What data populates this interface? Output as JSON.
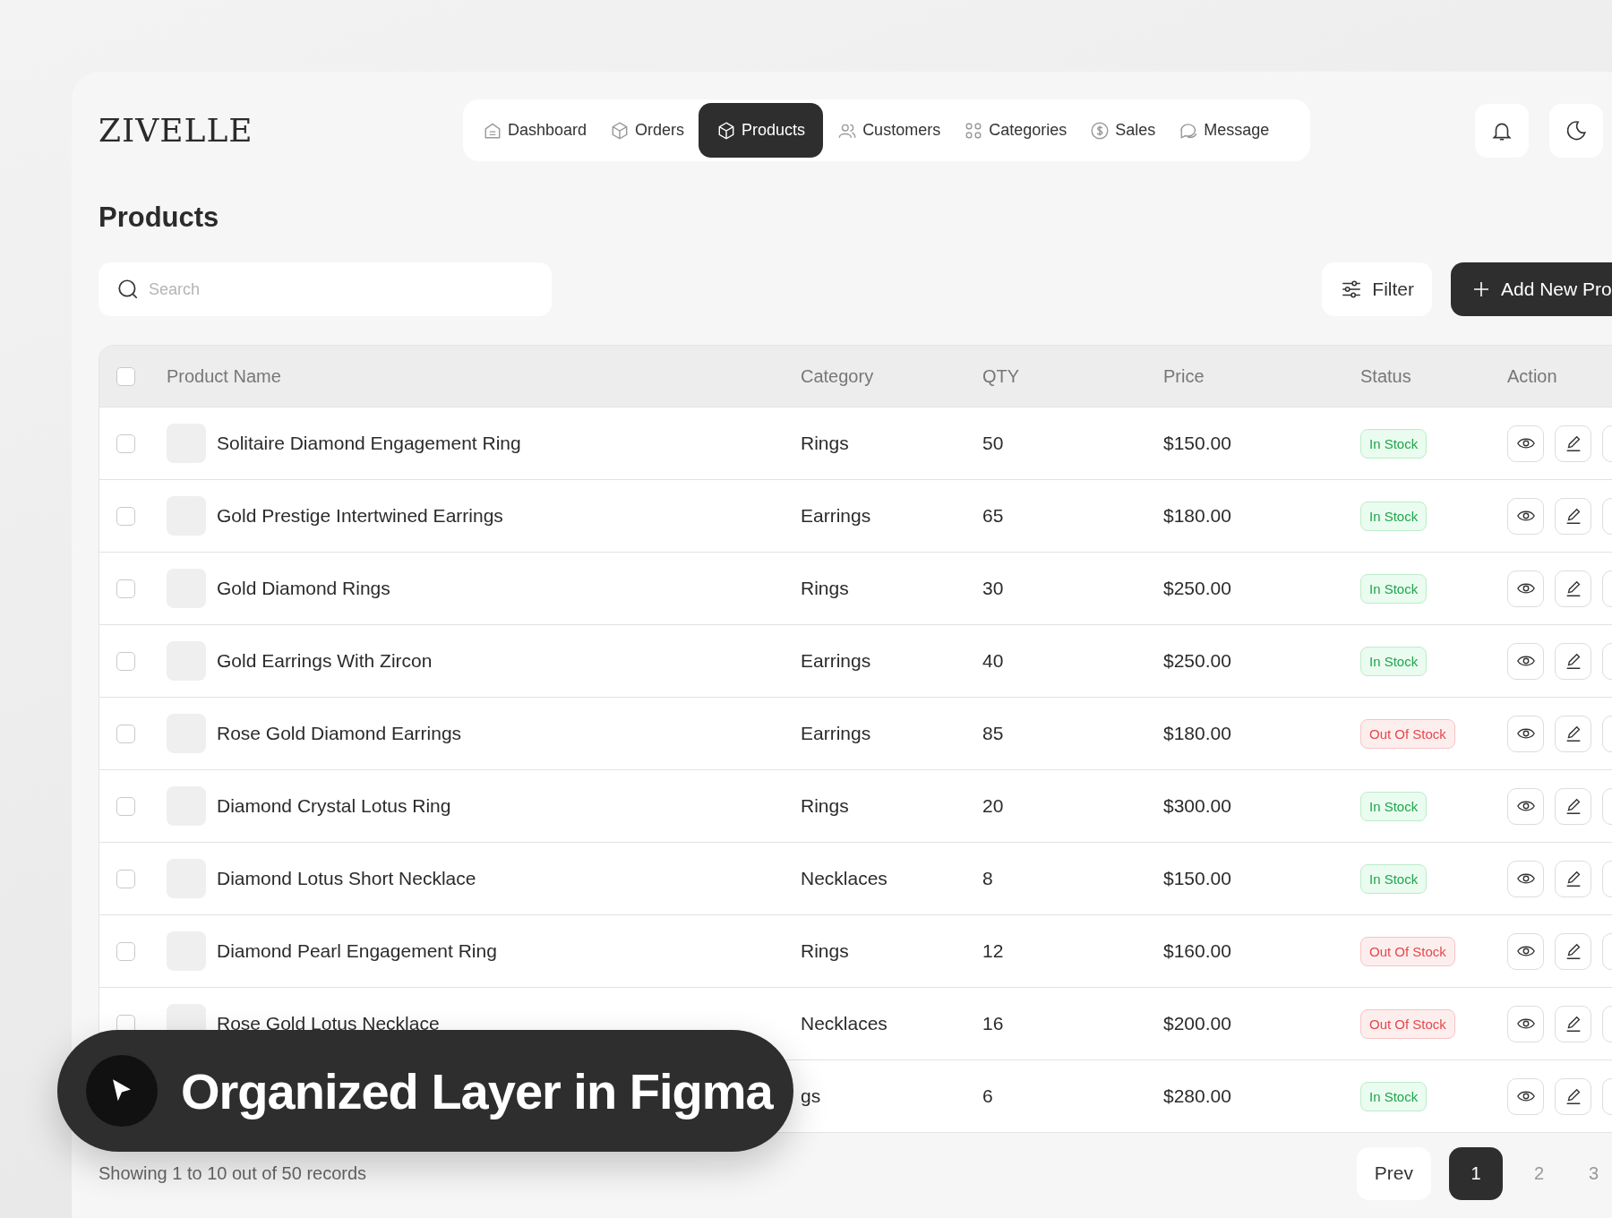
{
  "logo": "ZIVELLE",
  "nav": [
    {
      "label": "Dashboard",
      "selected": false
    },
    {
      "label": "Orders",
      "selected": false
    },
    {
      "label": "Products",
      "selected": true
    },
    {
      "label": "Customers",
      "selected": false
    },
    {
      "label": "Categories",
      "selected": false
    },
    {
      "label": "Sales",
      "selected": false
    },
    {
      "label": "Message",
      "selected": false
    }
  ],
  "page_title": "Products",
  "search": {
    "placeholder": "Search"
  },
  "filter_button": "Filter",
  "add_button": "Add New Pro",
  "table": {
    "columns": [
      "Product Name",
      "Category",
      "QTY",
      "Price",
      "Status",
      "Action"
    ],
    "select_all_checked": false,
    "rows": [
      {
        "checked": false,
        "name": "Solitaire Diamond Engagement Ring",
        "category": "Rings",
        "qty": "50",
        "price": "$150.00",
        "status": "In Stock",
        "kind": "in_stock"
      },
      {
        "checked": false,
        "name": "Gold Prestige Intertwined Earrings",
        "category": "Earrings",
        "qty": "65",
        "price": "$180.00",
        "status": "In Stock",
        "kind": "in_stock"
      },
      {
        "checked": false,
        "name": "Gold Diamond Rings",
        "category": "Rings",
        "qty": "30",
        "price": "$250.00",
        "status": "In Stock",
        "kind": "in_stock"
      },
      {
        "checked": false,
        "name": "Gold Earrings With Zircon",
        "category": "Earrings",
        "qty": "40",
        "price": "$250.00",
        "status": "In Stock",
        "kind": "in_stock"
      },
      {
        "checked": false,
        "name": "Rose Gold Diamond Earrings",
        "category": "Earrings",
        "qty": "85",
        "price": "$180.00",
        "status": "Out Of Stock",
        "kind": "out_of_stock"
      },
      {
        "checked": false,
        "name": "Diamond Crystal Lotus Ring",
        "category": "Rings",
        "qty": "20",
        "price": "$300.00",
        "status": "In Stock",
        "kind": "in_stock"
      },
      {
        "checked": false,
        "name": "Diamond Lotus Short Necklace",
        "category": "Necklaces",
        "qty": "8",
        "price": "$150.00",
        "status": "In Stock",
        "kind": "in_stock"
      },
      {
        "checked": false,
        "name": "Diamond Pearl Engagement Ring",
        "category": "Rings",
        "qty": "12",
        "price": "$160.00",
        "status": "Out Of Stock",
        "kind": "out_of_stock"
      },
      {
        "checked": false,
        "name": "Rose Gold Lotus Necklace",
        "category": "Necklaces",
        "qty": "16",
        "price": "$200.00",
        "status": "Out Of Stock",
        "kind": "out_of_stock"
      },
      {
        "category": "gs",
        "qty": "6",
        "price": "$280.00",
        "status": "In Stock",
        "kind": "in_stock"
      }
    ]
  },
  "footer_text": "Showing 1 to 10 out of 50 records",
  "pagination": {
    "prev": "Prev",
    "pages": [
      {
        "label": "1",
        "selected": true
      },
      {
        "label": "2",
        "selected": false
      },
      {
        "label": "3",
        "selected": false
      }
    ]
  },
  "overlay_banner": "Organized Layer in Figma"
}
